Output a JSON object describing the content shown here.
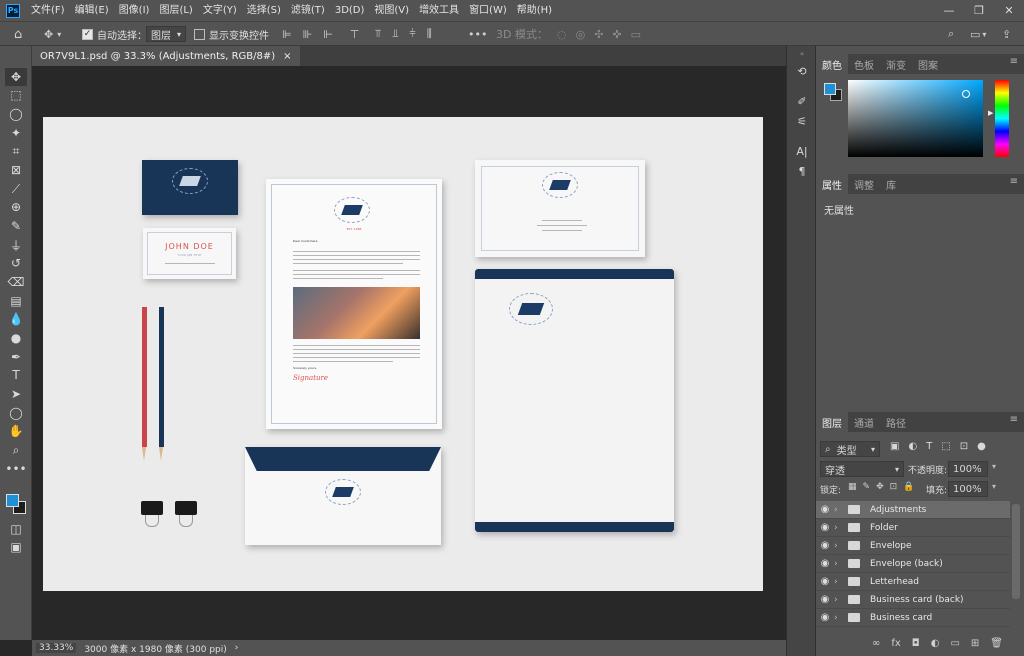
{
  "menubar": {
    "app_icon": "Ps",
    "items": [
      "文件(F)",
      "编辑(E)",
      "图像(I)",
      "图层(L)",
      "文字(Y)",
      "选择(S)",
      "滤镜(T)",
      "3D(D)",
      "视图(V)",
      "增效工具",
      "窗口(W)",
      "帮助(H)"
    ],
    "window_controls": [
      "—",
      "❐",
      "✕"
    ]
  },
  "options": {
    "auto_select_label": "自动选择：",
    "auto_select_value": "图层",
    "show_transform_label": "显示变换控件",
    "mode_3d_label": "3D 模式："
  },
  "document": {
    "tab_title": "OR7V9L1.psd @ 33.3% (Adjustments, RGB/8#)",
    "close": "×"
  },
  "status": {
    "zoom": "33.33%",
    "doc_info": "3000 像素 x 1980 像素 (300 ppi)",
    "arrow": "›"
  },
  "color_panel": {
    "tabs": [
      "颜色",
      "色板",
      "渐变",
      "图案"
    ],
    "foreground": "#1f8fd6",
    "background": "#1d1d1d"
  },
  "properties_panel": {
    "tabs": [
      "属性",
      "调整",
      "库"
    ],
    "empty_label": "无属性"
  },
  "layers_panel": {
    "tabs": [
      "图层",
      "通道",
      "路径"
    ],
    "filter_label": "类型",
    "blend_mode": "穿透",
    "opacity_label": "不透明度:",
    "opacity_value": "100%",
    "lock_label": "锁定:",
    "fill_label": "填充:",
    "fill_value": "100%",
    "layers": [
      {
        "name": "Adjustments",
        "selected": true
      },
      {
        "name": "Folder",
        "selected": false
      },
      {
        "name": "Envelope",
        "selected": false
      },
      {
        "name": "Envelope (back)",
        "selected": false
      },
      {
        "name": "Letterhead",
        "selected": false
      },
      {
        "name": "Business card (back)",
        "selected": false
      },
      {
        "name": "Business card",
        "selected": false
      }
    ]
  },
  "mockup": {
    "card_name": "JOHN DOE",
    "card_sub": "YOUR JOB TITLE",
    "letter_greeting": "Dear Customers,",
    "letter_closing": "Sincerely yours,",
    "signature": "Signature",
    "brand_tag": "EST. 1988"
  },
  "colors": {
    "navy": "#183456",
    "accent_red": "#d9534f",
    "ps_blue": "#31a8ff"
  }
}
